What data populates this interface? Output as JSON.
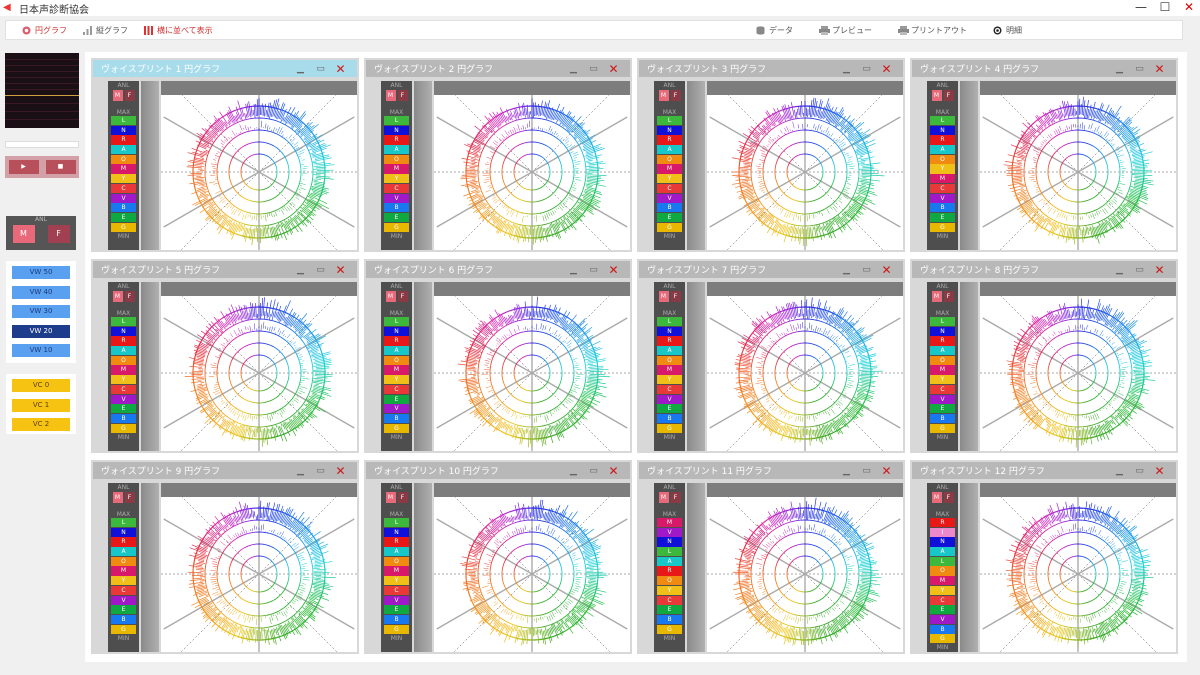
{
  "app": {
    "title": "日本声診断協会",
    "window_buttons": [
      "—",
      "☐",
      "✕"
    ]
  },
  "toolbar": {
    "left": [
      {
        "label": "円グラフ",
        "icon": "pie-chart-icon",
        "active": true
      },
      {
        "label": "縦グラフ",
        "icon": "bar-chart-icon",
        "active": false
      },
      {
        "label": "横に並べて表示",
        "icon": "tile-icon",
        "active": true
      }
    ],
    "right": [
      {
        "label": "データ",
        "icon": "database-icon"
      },
      {
        "label": "プレビュー",
        "icon": "printer-icon"
      },
      {
        "label": "プリントアウト",
        "icon": "printer-icon"
      },
      {
        "label": "明細",
        "icon": "target-icon"
      }
    ]
  },
  "sidebar": {
    "anl_label": "ANL",
    "gender": [
      "M",
      "F"
    ],
    "vw_buttons": [
      {
        "label": "VW 50",
        "active": false
      },
      {
        "label": "VW 40",
        "active": false
      },
      {
        "label": "VW 30",
        "active": false
      },
      {
        "label": "VW 20",
        "active": true
      },
      {
        "label": "VW 10",
        "active": false
      }
    ],
    "vc_buttons": [
      "VC 0",
      "VC 1",
      "VC 2"
    ]
  },
  "colors": {
    "L": "#3cb83c",
    "N": "#1010d8",
    "R": "#e81818",
    "A": "#18c8c8",
    "O": "#f08a10",
    "M": "#d81868",
    "Y": "#f0c018",
    "C": "#e83838",
    "V": "#a018c8",
    "E": "#10a840",
    "B": "#1878f0",
    "G": "#e8b800",
    "I": "#ee88cc"
  },
  "panels": [
    {
      "title": "ヴォイスプリント 1 円グラフ",
      "active": true,
      "anl": "ANL",
      "max": "MAX",
      "min": "MIN",
      "legend": [
        "L",
        "N",
        "R",
        "A",
        "O",
        "M",
        "Y",
        "C",
        "V",
        "B",
        "E",
        "G"
      ]
    },
    {
      "title": "ヴォイスプリント 2 円グラフ",
      "active": false,
      "anl": "ANL",
      "max": "MAX",
      "min": "MIN",
      "legend": [
        "L",
        "N",
        "R",
        "A",
        "O",
        "M",
        "Y",
        "C",
        "V",
        "B",
        "E",
        "G"
      ]
    },
    {
      "title": "ヴォイスプリント 3 円グラフ",
      "active": false,
      "anl": "ANL",
      "max": "MAX",
      "min": "MIN",
      "legend": [
        "L",
        "N",
        "R",
        "A",
        "O",
        "M",
        "Y",
        "C",
        "V",
        "B",
        "E",
        "G"
      ]
    },
    {
      "title": "ヴォイスプリント 4 円グラフ",
      "active": false,
      "anl": "ANL",
      "max": "MAX",
      "min": "MIN",
      "legend": [
        "L",
        "N",
        "R",
        "A",
        "O",
        "Y",
        "M",
        "C",
        "V",
        "B",
        "E",
        "G"
      ]
    },
    {
      "title": "ヴォイスプリント 5 円グラフ",
      "active": false,
      "anl": "ANL",
      "max": "MAX",
      "min": "MIN",
      "legend": [
        "L",
        "N",
        "R",
        "A",
        "O",
        "M",
        "Y",
        "C",
        "V",
        "E",
        "B",
        "G"
      ]
    },
    {
      "title": "ヴォイスプリント 6 円グラフ",
      "active": false,
      "anl": "ANL",
      "max": "MAX",
      "min": "MIN",
      "legend": [
        "L",
        "N",
        "R",
        "A",
        "O",
        "M",
        "Y",
        "C",
        "E",
        "V",
        "B",
        "G"
      ]
    },
    {
      "title": "ヴォイスプリント 7 円グラフ",
      "active": false,
      "anl": "ANL",
      "max": "MAX",
      "min": "MIN",
      "legend": [
        "L",
        "N",
        "R",
        "A",
        "O",
        "M",
        "Y",
        "C",
        "V",
        "E",
        "B",
        "G"
      ]
    },
    {
      "title": "ヴォイスプリント 8 円グラフ",
      "active": false,
      "anl": "ANL",
      "max": "MAX",
      "min": "MIN",
      "legend": [
        "L",
        "N",
        "R",
        "A",
        "O",
        "M",
        "Y",
        "C",
        "V",
        "E",
        "B",
        "G"
      ]
    },
    {
      "title": "ヴォイスプリント 9 円グラフ",
      "active": false,
      "anl": "ANL",
      "max": "MAX",
      "min": "MIN",
      "legend": [
        "L",
        "N",
        "R",
        "A",
        "O",
        "M",
        "Y",
        "C",
        "V",
        "E",
        "B",
        "G"
      ]
    },
    {
      "title": "ヴォイスプリント 10 円グラフ",
      "active": false,
      "anl": "ANL",
      "max": "MAX",
      "min": "MIN",
      "legend": [
        "L",
        "N",
        "R",
        "A",
        "O",
        "M",
        "Y",
        "C",
        "V",
        "E",
        "B",
        "G"
      ]
    },
    {
      "title": "ヴォイスプリント 11 円グラフ",
      "active": false,
      "anl": "ANL",
      "max": "MAX",
      "min": "MIN",
      "legend": [
        "M",
        "V",
        "N",
        "L",
        "A",
        "R",
        "O",
        "Y",
        "C",
        "E",
        "B",
        "G"
      ]
    },
    {
      "title": "ヴォイスプリント 12 円グラフ",
      "active": false,
      "anl": "ANL",
      "max": "MAX",
      "min": "MIN",
      "legend": [
        "R",
        "I",
        "N",
        "A",
        "L",
        "O",
        "M",
        "Y",
        "C",
        "E",
        "V",
        "B",
        "G"
      ]
    }
  ]
}
